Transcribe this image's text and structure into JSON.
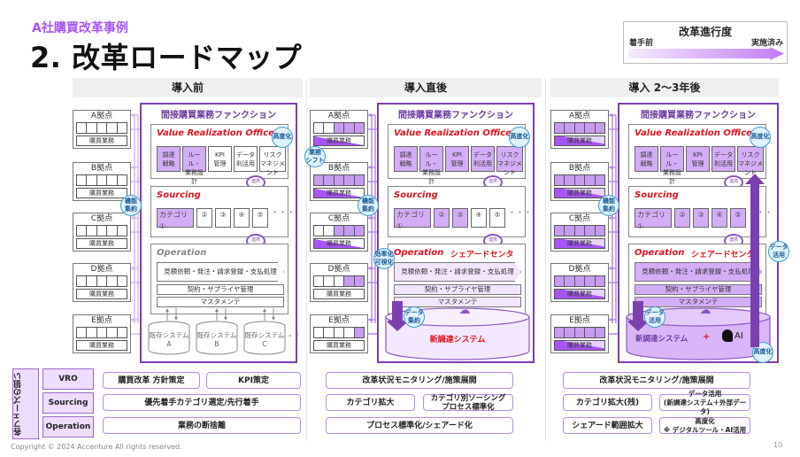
{
  "header": {
    "subtitle": "A社購買改革事例",
    "title": "2. 改革ロードマップ"
  },
  "legend": {
    "title": "改革進行度",
    "from_label": "着手前",
    "to_label": "実施済み",
    "colors": {
      "start": "#f4ecfd",
      "end": "#c27cf6"
    }
  },
  "colors": {
    "accent": "#a855f7",
    "function_border": "#7b3fb0",
    "done_fill": "#d4adf7",
    "title_red": "#e0141e",
    "badge_border": "#3a9bd5"
  },
  "phases": [
    {
      "header": "導入前",
      "function_title": "間接購買業務ファンクション",
      "sites": [
        {
          "name": "A拠点",
          "job": "購買業務",
          "filled": 0,
          "job_fill": "none"
        },
        {
          "name": "B拠点",
          "job": "購買業務",
          "filled": 0,
          "job_fill": "none"
        },
        {
          "name": "C拠点",
          "job": "購買業務",
          "filled": 0,
          "job_fill": "none"
        },
        {
          "name": "D拠点",
          "job": "購買業務",
          "filled": 0,
          "job_fill": "none"
        },
        {
          "name": "E拠点",
          "job": "購買業務",
          "filled": 0,
          "job_fill": "none"
        }
      ],
      "vro": {
        "title": "Value Realization Office",
        "badge": "高度化",
        "items": [
          {
            "label": "調達\n戦略",
            "done": true
          },
          {
            "label": "ルール・\n業務設計",
            "done": true
          },
          {
            "label": "KPI\n管理",
            "done": false
          },
          {
            "label": "データ\n利活用",
            "done": false
          },
          {
            "label": "リスク\nマネジメント",
            "done": false
          }
        ],
        "cycle": "連携"
      },
      "sourcing": {
        "title": "Sourcing",
        "badge": "機能\n集約",
        "items": [
          {
            "label": "カテゴリ①",
            "done": true
          },
          {
            "label": "②",
            "done": false
          },
          {
            "label": "③",
            "done": false
          },
          {
            "label": "④",
            "done": false
          },
          {
            "label": "⑤",
            "done": false
          }
        ],
        "more": "・・・",
        "cycle": "連携"
      },
      "operation": {
        "title": "Operation",
        "subtitle": "",
        "main": "見積依頼・発注・請求登録・支払処理",
        "rows": [
          "契約・サプライヤ管理",
          "マスタメンテ"
        ],
        "done": false
      },
      "systems": [
        "既存システム\nA",
        "既存システム\nB",
        "既存システム\nC"
      ],
      "systems_more": "・・"
    },
    {
      "header": "導入直後",
      "function_title": "間接購買業務ファンクション",
      "sites": [
        {
          "name": "A拠点",
          "job": "購買業務",
          "filled": 3,
          "job_fill": "half"
        },
        {
          "name": "B拠点",
          "job": "購買業務",
          "filled": 5,
          "job_fill": "half"
        },
        {
          "name": "C拠点",
          "job": "購買業務",
          "filled": 3,
          "job_fill": "half"
        },
        {
          "name": "D拠点",
          "job": "購買業務",
          "filled": 2,
          "job_fill": "none"
        },
        {
          "name": "E拠点",
          "job": "購買業務",
          "filled": 1,
          "job_fill": "none"
        }
      ],
      "shift_badge": "業務\nシフト",
      "vro": {
        "title": "Value Realization Office",
        "badge": "高度化",
        "items": [
          {
            "label": "調達\n戦略",
            "done": true
          },
          {
            "label": "ルール・\n業務設計",
            "done": true
          },
          {
            "label": "KPI\n管理",
            "done": true
          },
          {
            "label": "データ\n利活用",
            "done": true
          },
          {
            "label": "リスク\nマネジメント",
            "done": true
          }
        ],
        "cycle": "連携"
      },
      "sourcing": {
        "title": "Sourcing",
        "badge": "機能\n集約",
        "items": [
          {
            "label": "カテゴリ①",
            "done": true
          },
          {
            "label": "②",
            "done": true
          },
          {
            "label": "③",
            "done": true
          },
          {
            "label": "④",
            "done": false
          },
          {
            "label": "⑤",
            "done": false
          }
        ],
        "more": "・・・",
        "cycle": "連携"
      },
      "operation": {
        "title": "Operation",
        "subtitle": "シェアードセンタ",
        "badge": "効率化\n可視化",
        "main": "見積依頼・発注・請求登録・支払処理",
        "rows": [
          "契約・サプライヤ管理",
          "マスタメンテ"
        ],
        "done": "light"
      },
      "new_system": {
        "label": "新調達システム",
        "badge": "データ\n集約"
      }
    },
    {
      "header": "導入 2〜3年後",
      "function_title": "間接購買業務ファンクション",
      "sites": [
        {
          "name": "A拠点",
          "job": "購買業務",
          "filled": 5,
          "job_fill": "half2"
        },
        {
          "name": "B拠点",
          "job": "購買業務",
          "filled": 5,
          "job_fill": "half2"
        },
        {
          "name": "C拠点",
          "job": "購買業務",
          "filled": 5,
          "job_fill": "half2"
        },
        {
          "name": "D拠点",
          "job": "購買業務",
          "filled": 5,
          "job_fill": "half2"
        },
        {
          "name": "E拠点",
          "job": "購買業務",
          "filled": 5,
          "job_fill": "half2"
        }
      ],
      "vro": {
        "title": "Value Realization Office",
        "badge": "高度化",
        "items": [
          {
            "label": "調達\n戦略",
            "done": true
          },
          {
            "label": "ルール・\n業務設計",
            "done": true
          },
          {
            "label": "KPI\n管理",
            "done": true
          },
          {
            "label": "データ\n利活用",
            "done": true
          },
          {
            "label": "リスク\nマネジメント",
            "done": true
          }
        ],
        "cycle": "連携"
      },
      "sourcing": {
        "title": "Sourcing",
        "badge": "機能\n集約",
        "items": [
          {
            "label": "カテゴリ①",
            "done": true
          },
          {
            "label": "②",
            "done": true
          },
          {
            "label": "③",
            "done": true
          },
          {
            "label": "④",
            "done": true
          },
          {
            "label": "⑤",
            "done": true
          }
        ],
        "more": "・・・",
        "cycle": "連携"
      },
      "operation": {
        "title": "Operation",
        "subtitle": "シェアードセンタ",
        "main": "見積依頼・発注・請求登録・支払処理",
        "rows": [
          "契約・サプライヤ管理",
          "マスタメンテ"
        ],
        "done": true
      },
      "side_badge": "データ\n活用",
      "new_system": {
        "label": "新調達システム",
        "plus": "+",
        "ai": "AI",
        "badge": "データ\n活用",
        "badge2": "高度化"
      }
    }
  ],
  "aims": {
    "side_label": "各フェーズの狙い",
    "rows": [
      "VRO",
      "Sourcing",
      "Operation"
    ],
    "phase1": {
      "vro": [
        "購買改革 方針策定",
        "KPI策定"
      ],
      "sourcing": [
        "優先着手カテゴリ選定/先行着手"
      ],
      "operation": [
        "業務の断捨離"
      ]
    },
    "phase2": {
      "vro": [
        "改革状況モニタリング/施策展開"
      ],
      "sourcing": [
        "カテゴリ拡大",
        "カテゴリ別ソーシング\nプロセス標準化"
      ],
      "operation": [
        "プロセス標準化/シェアード化"
      ]
    },
    "phase3": {
      "vro": [
        "改革状況モニタリング/施策展開"
      ],
      "sourcing": [
        "カテゴリ拡大(残)",
        "データ活用\n(新調達システム＋外部データ)"
      ],
      "operation": [
        "シェアード範囲拡大",
        "高度化\n※ デジタルツール・AI活用"
      ]
    }
  },
  "footer": {
    "copyright": "Copyright © 2024 Accenture  All rights reserved.",
    "page": "10"
  }
}
